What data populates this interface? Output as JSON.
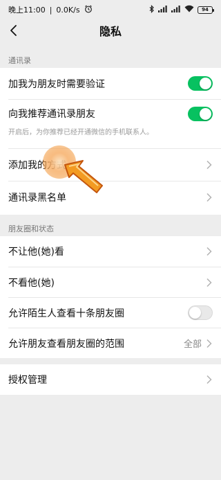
{
  "status_bar": {
    "time": "晚上11:00",
    "speed": "0.0K/s",
    "battery": "94",
    "icons": [
      "alarm-icon",
      "bluetooth-icon",
      "signal-icon",
      "wifi-icon",
      "battery-icon"
    ]
  },
  "nav": {
    "title": "隐私",
    "back_icon": "back-arrow-icon"
  },
  "contacts_section": {
    "header": "通讯录",
    "items": [
      {
        "label": "加我为朋友时需要验证",
        "toggle": "on"
      },
      {
        "label": "向我推荐通讯录朋友",
        "toggle": "on",
        "hint": "开启后，为你推荐已经开通微信的手机联系人。"
      },
      {
        "label": "添加我的方式"
      },
      {
        "label": "通讯录黑名单"
      }
    ]
  },
  "moments_section": {
    "header": "朋友圈和状态",
    "items": [
      {
        "label": "不让他(她)看"
      },
      {
        "label": "不看他(她)"
      },
      {
        "label": "允许陌生人查看十条朋友圈",
        "toggle": "off"
      },
      {
        "label": "允许朋友查看朋友圈的范围",
        "value": "全部"
      }
    ]
  },
  "auth_section": {
    "items": [
      {
        "label": "授权管理"
      }
    ]
  },
  "colors": {
    "accent": "#07c160",
    "background": "#ededed",
    "overlay": "#f5a623"
  }
}
